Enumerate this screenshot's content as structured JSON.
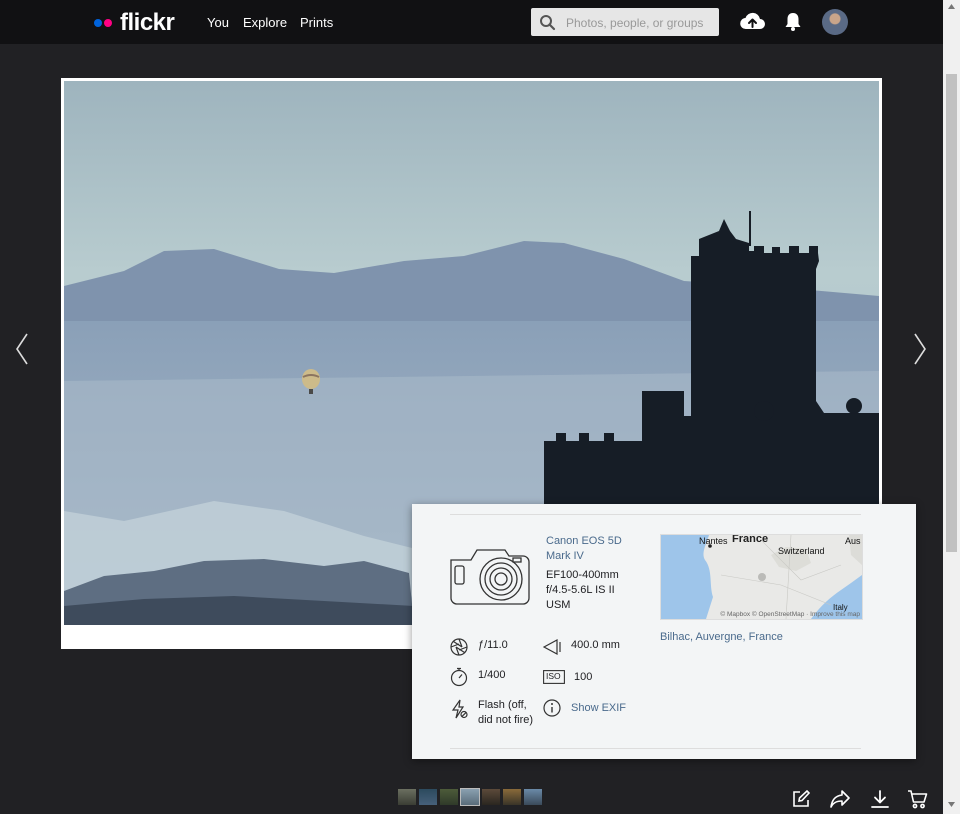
{
  "brand": {
    "name": "flickr"
  },
  "nav": {
    "you": "You",
    "explore": "Explore",
    "prints": "Prints"
  },
  "search": {
    "placeholder": "Photos, people, or groups"
  },
  "icons": {
    "upload": "cloud-upload-icon",
    "notifications": "bell-icon",
    "prev": "chevron-left-icon",
    "next": "chevron-right-icon",
    "edit": "edit-icon",
    "share": "share-icon",
    "download": "download-icon",
    "cart": "cart-icon"
  },
  "colors": {
    "accent_blue": "#0063dc",
    "accent_pink": "#ff0084",
    "link": "#4a6a8c"
  },
  "exif": {
    "camera": "Canon EOS 5D Mark IV",
    "lens": "EF100-400mm f/4.5-5.6L IS II USM",
    "aperture": "ƒ/11.0",
    "focal_length": "400.0 mm",
    "shutter": "1/400",
    "iso": "100",
    "iso_badge": "ISO",
    "flash": "Flash (off, did not fire)",
    "show_exif": "Show EXIF"
  },
  "map": {
    "labels": {
      "nantes": "Nantes",
      "france": "France",
      "switzerland": "Switzerland",
      "aus": "Aus",
      "italy": "Italy"
    },
    "credit": "© Mapbox © OpenStreetMap · Improve this map"
  },
  "location": "Bilhac, Auvergne, France"
}
